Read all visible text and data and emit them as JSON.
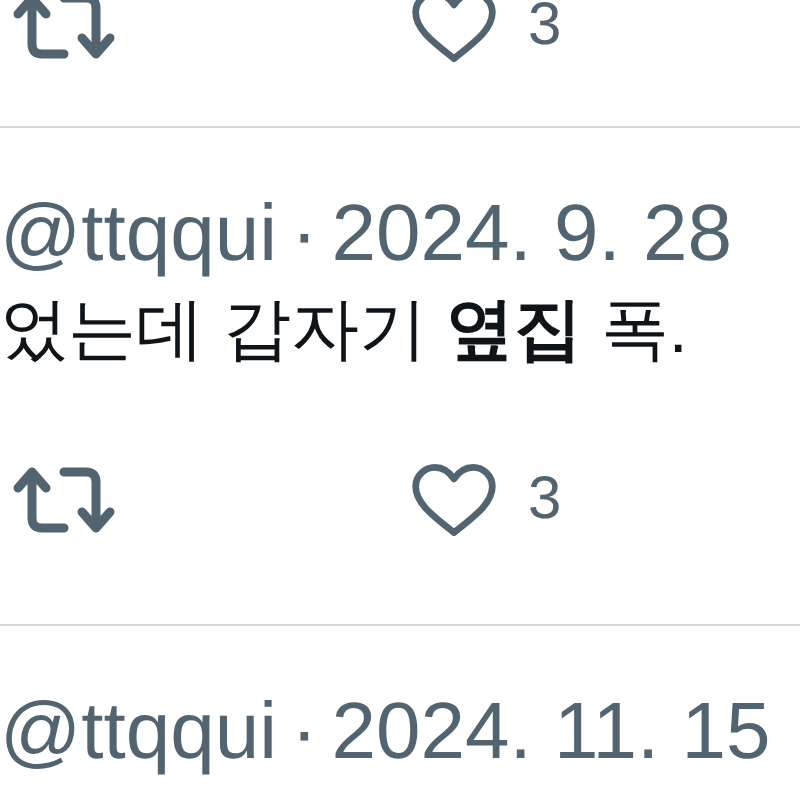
{
  "tweets": [
    {
      "actions": [
        {
          "kind": "retweet"
        },
        {
          "kind": "like",
          "count": "3"
        }
      ]
    },
    {
      "handle": "@ttqqui",
      "separator": "·",
      "date": "2024. 9. 28",
      "text": "었는데 갑자기 **옆집** 폭.",
      "actions": [
        {
          "kind": "retweet"
        },
        {
          "kind": "like",
          "count": "3"
        }
      ]
    },
    {
      "handle": "@ttqqui",
      "separator": "·",
      "date": "2024. 11. 15"
    }
  ]
}
